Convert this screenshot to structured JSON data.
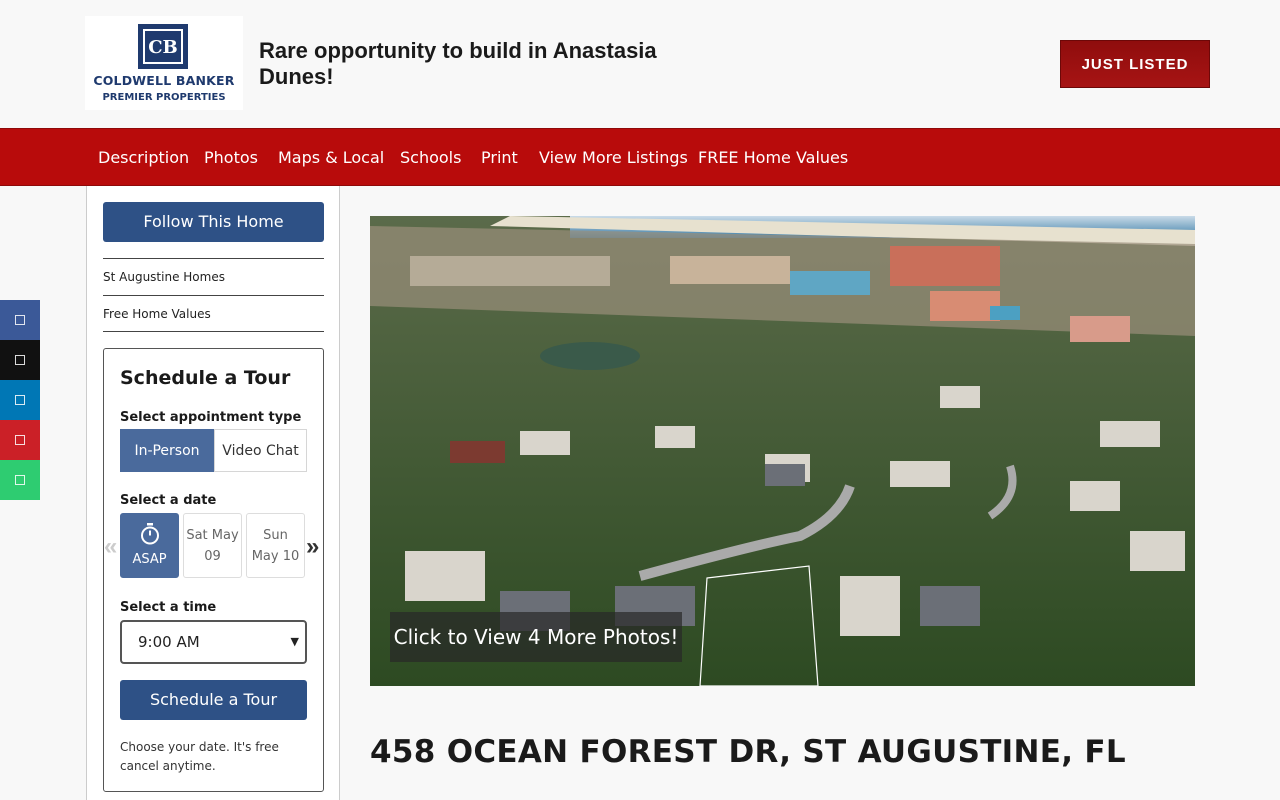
{
  "brand": {
    "logo_mark": "CB",
    "name": "COLDWELL BANKER",
    "subtitle": "PREMIER PROPERTIES",
    "color": "#1f3a6e"
  },
  "header": {
    "headline": "Rare opportunity to build in Anastasia Dunes!",
    "badge_label": "JUST LISTED",
    "badge_color": "#a71414"
  },
  "nav": {
    "color": "#b80b0b",
    "items": [
      "Description",
      "Photos",
      "Maps & Local",
      "Schools",
      "Print",
      "View More Listings",
      "FREE Home Values"
    ]
  },
  "sidebar": {
    "follow_label": "Follow This Home",
    "links": [
      "St Augustine Homes",
      "Free Home Values"
    ]
  },
  "tour": {
    "title": "Schedule a Tour",
    "type_label": "Select appointment type",
    "types": [
      "In-Person",
      "Video Chat"
    ],
    "date_label": "Select a date",
    "dates": [
      {
        "icon": "stopwatch-icon",
        "line2": "ASAP"
      },
      {
        "line1": "Sat May",
        "line2": "09"
      },
      {
        "line1": "Sun",
        "line2": "May 10"
      }
    ],
    "prev_arrow": "«",
    "next_arrow": "»",
    "time_label": "Select a time",
    "time_value": "9:00 AM",
    "submit_label": "Schedule a Tour",
    "note": "Choose your date. It's free cancel anytime.",
    "accent": "#2e5186"
  },
  "share": {
    "buttons": [
      {
        "name": "facebook-share-icon",
        "color": "#3b5998"
      },
      {
        "name": "x-share-icon",
        "color": "#111111"
      },
      {
        "name": "linkedin-share-icon",
        "color": "#0077b5"
      },
      {
        "name": "pinterest-share-icon",
        "color": "#cb2027"
      },
      {
        "name": "email-share-icon",
        "color": "#2ecc71"
      }
    ]
  },
  "photo": {
    "caption": "Click to View 4 More Photos!"
  },
  "listing": {
    "address": "458 OCEAN FOREST DR, ST AUGUSTINE, FL"
  }
}
